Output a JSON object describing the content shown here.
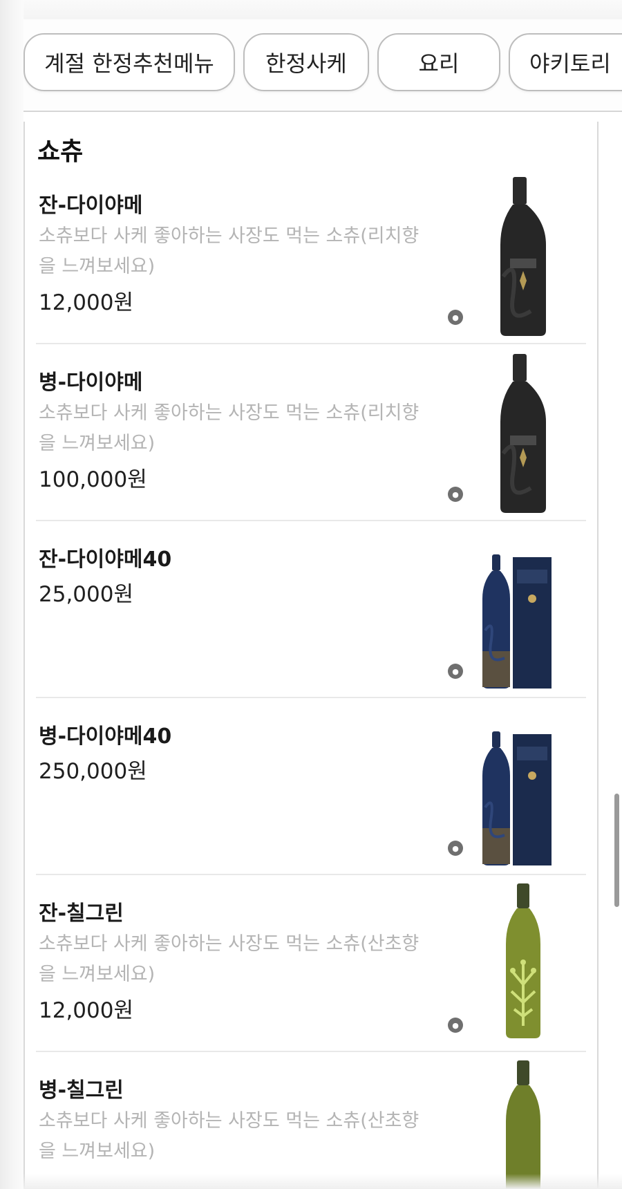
{
  "categories": [
    {
      "label": "계절 한정추천메뉴"
    },
    {
      "label": "한정사케"
    },
    {
      "label": "요리"
    },
    {
      "label": "야키토리"
    }
  ],
  "section": {
    "title": "쇼츄"
  },
  "items": [
    {
      "name": "잔-다이야메",
      "description": "소츄보다 사케 좋아하는 사장도 먹는 소츄(리치향을 느껴보세요)",
      "price": "12,000원",
      "image": "dark-bottle"
    },
    {
      "name": "병-다이야메",
      "description": "소츄보다 사케 좋아하는 사장도 먹는 소츄(리치향을 느껴보세요)",
      "price": "100,000원",
      "image": "dark-bottle"
    },
    {
      "name": "잔-다이야메40",
      "description": "",
      "price": "25,000원",
      "image": "navy-bottle-box"
    },
    {
      "name": "병-다이야메40",
      "description": "",
      "price": "250,000원",
      "image": "navy-bottle-box"
    },
    {
      "name": "잔-칠그린",
      "description": "소츄보다 사케 좋아하는 사장도 먹는 소츄(산초향을 느껴보세요)",
      "price": "12,000원",
      "image": "green-bottle"
    },
    {
      "name": "병-칠그린",
      "description": "소츄보다 사케 좋아하는 사장도 먹는 소츄(산초향을 느껴보세요)",
      "price": "",
      "image": "green-bottle"
    }
  ],
  "badges": {
    "icon": "info-badge-icon"
  },
  "colors": {
    "description": "#b4b4b4",
    "divider": "#e8e8e8",
    "chip_border": "#bdbdbd"
  }
}
